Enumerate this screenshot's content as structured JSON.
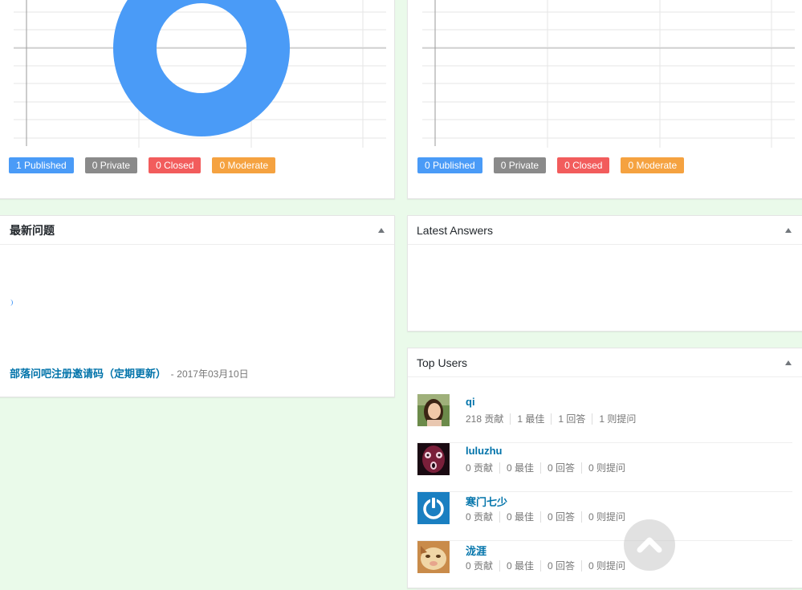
{
  "colors": {
    "published": "#4a9bf7",
    "private": "#8a8a8a",
    "closed": "#f25c5c",
    "moderate": "#f5a240",
    "link": "#0073aa",
    "page_bg": "#eafaea"
  },
  "question_stats": {
    "badges": {
      "published": "1 Published",
      "private": "0 Private",
      "closed": "0 Closed",
      "moderate": "0 Moderate"
    },
    "chart_data": {
      "type": "pie",
      "labels": [
        "Published",
        "Private",
        "Closed",
        "Moderate"
      ],
      "values": [
        1,
        0,
        0,
        0
      ],
      "grid": true
    }
  },
  "answer_stats": {
    "badges": {
      "published": "0 Published",
      "private": "0 Private",
      "closed": "0 Closed",
      "moderate": "0 Moderate"
    },
    "chart_data": {
      "type": "pie",
      "labels": [
        "Published",
        "Private",
        "Closed",
        "Moderate"
      ],
      "values": [
        0,
        0,
        0,
        0
      ],
      "grid": true
    }
  },
  "latest_questions": {
    "title": "最新问题",
    "items": [
      {
        "title": "部落问吧注册邀请码（定期更新）",
        "separator": "-",
        "date": "2017年03月10日"
      }
    ]
  },
  "latest_answers": {
    "title": "Latest Answers"
  },
  "top_users": {
    "title": "Top Users",
    "users": [
      {
        "name": "qi",
        "avatar": "photo-woman-avatar",
        "contrib": "218 贡献",
        "best": "1 最佳",
        "answers": "1 回答",
        "questions": "1 则提问"
      },
      {
        "name": "luluzhu",
        "avatar": "mask-avatar",
        "contrib": "0 贡献",
        "best": "0 最佳",
        "answers": "0 回答",
        "questions": "0 则提问"
      },
      {
        "name": "寒门七少",
        "avatar": "power-logo-avatar",
        "contrib": "0 贡献",
        "best": "0 最佳",
        "answers": "0 回答",
        "questions": "0 则提问"
      },
      {
        "name": "泷涯",
        "avatar": "cat-photo-avatar",
        "contrib": "0 贡献",
        "best": "0 最佳",
        "answers": "0 回答",
        "questions": "0 则提问"
      }
    ]
  },
  "scroll_top_icon": "chevron-up-icon"
}
